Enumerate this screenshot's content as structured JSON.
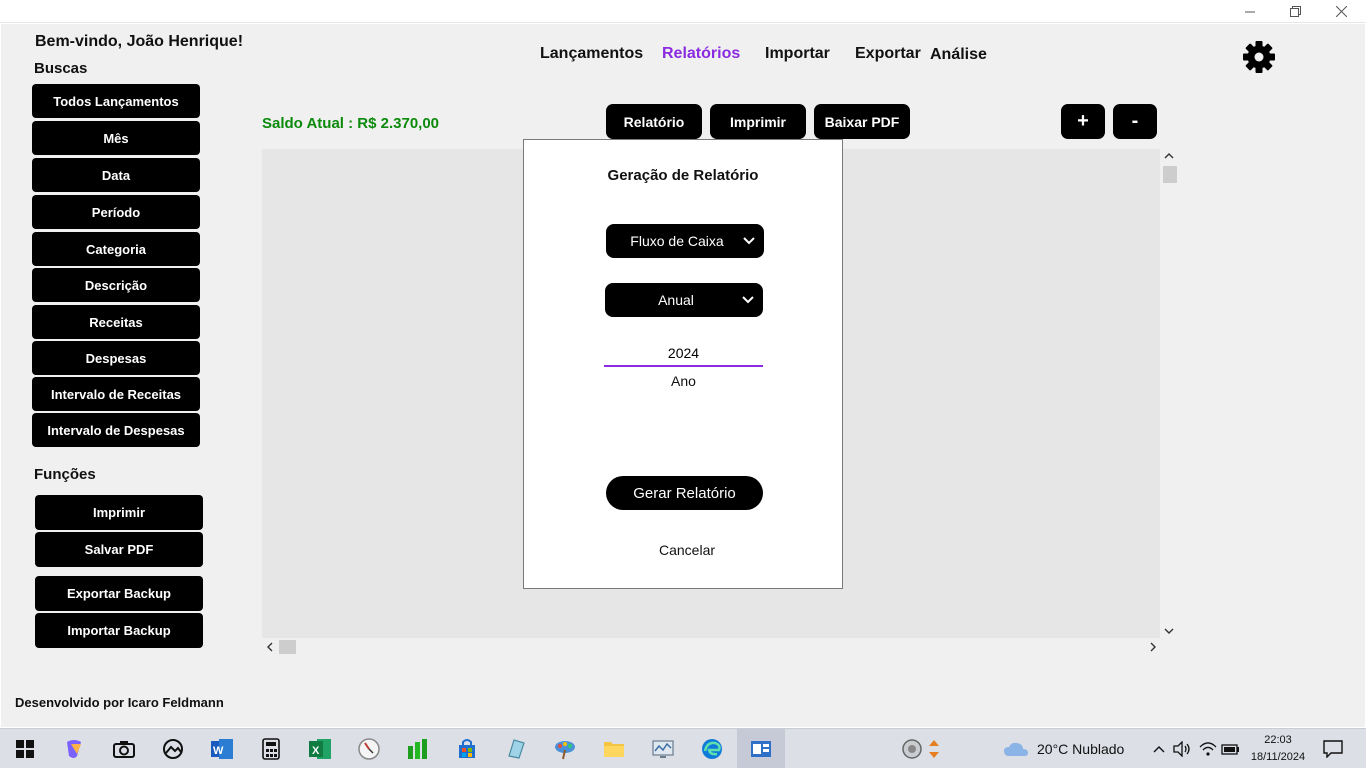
{
  "window": {
    "minimize_icon": "minimize-icon",
    "restore_icon": "restore-icon",
    "close_icon": "close-icon"
  },
  "header": {
    "welcome": "Bem-vindo, João Henrique!",
    "nav": [
      "Lançamentos",
      "Relatórios",
      "Importar",
      "Exportar",
      "Análise"
    ],
    "active_nav": "Relatórios",
    "settings_icon": "gear-icon"
  },
  "sidebar": {
    "search_title": "Buscas",
    "search_buttons": [
      "Todos Lançamentos",
      "Mês",
      "Data",
      "Período",
      "Categoria",
      "Descrição",
      "Receitas",
      "Despesas",
      "Intervalo de Receitas",
      "Intervalo de Despesas"
    ],
    "functions_title": "Funções",
    "function_buttons": [
      "Imprimir",
      "Salvar PDF",
      "Exportar Backup",
      "Importar Backup"
    ]
  },
  "toolbar": {
    "saldo": "Saldo Atual : R$ 2.370,00",
    "relatorio": "Relatório",
    "imprimir": "Imprimir",
    "baixar_pdf": "Baixar PDF",
    "zoom_in": "+",
    "zoom_out": "-"
  },
  "modal": {
    "title": "Geração de Relatório",
    "report_type": "Fluxo de Caixa",
    "period": "Anual",
    "year_value": "2024",
    "year_label": "Ano",
    "generate": "Gerar Relatório",
    "cancel": "Cancelar"
  },
  "footer": {
    "credit": "Desenvolvido por Icaro Feldmann"
  },
  "taskbar": {
    "weather": "20°C  Nublado",
    "time": "22:03",
    "date": "18/11/2024"
  },
  "colors": {
    "accent": "#8a2be2",
    "saldo": "#0b8a0b",
    "button": "#000000",
    "content_bg": "#e6e6e6"
  }
}
